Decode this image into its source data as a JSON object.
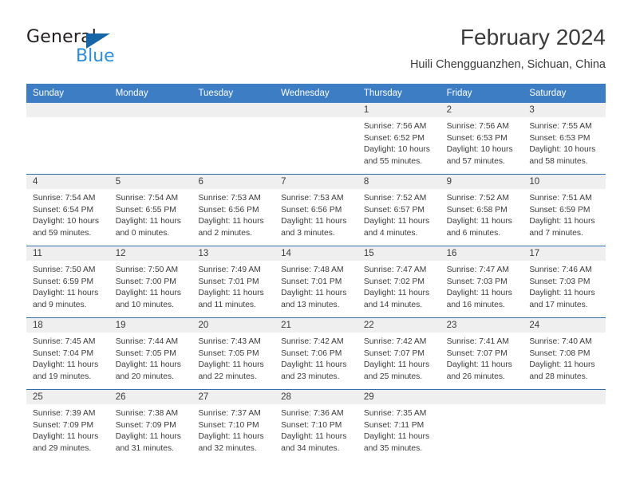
{
  "logo": {
    "word_one": "General",
    "word_two": "Blue",
    "triangle_color": "#1565a8",
    "blue_color": "#2d8fd5"
  },
  "header": {
    "month_title": "February 2024",
    "location": "Huili Chengguanzhen, Sichuan, China"
  },
  "theme": {
    "header_bar": "#3c7dc4",
    "row_divider": "#2f6fb0",
    "day_head_bg": "#efefef",
    "text": "#3b3b3b"
  },
  "weekdays": [
    "Sunday",
    "Monday",
    "Tuesday",
    "Wednesday",
    "Thursday",
    "Friday",
    "Saturday"
  ],
  "weeks": [
    [
      {
        "date": "",
        "lines": [
          "",
          "",
          "",
          ""
        ]
      },
      {
        "date": "",
        "lines": [
          "",
          "",
          "",
          ""
        ]
      },
      {
        "date": "",
        "lines": [
          "",
          "",
          "",
          ""
        ]
      },
      {
        "date": "",
        "lines": [
          "",
          "",
          "",
          ""
        ]
      },
      {
        "date": "1",
        "lines": [
          "Sunrise: 7:56 AM",
          "Sunset: 6:52 PM",
          "Daylight: 10 hours",
          "and 55 minutes."
        ]
      },
      {
        "date": "2",
        "lines": [
          "Sunrise: 7:56 AM",
          "Sunset: 6:53 PM",
          "Daylight: 10 hours",
          "and 57 minutes."
        ]
      },
      {
        "date": "3",
        "lines": [
          "Sunrise: 7:55 AM",
          "Sunset: 6:53 PM",
          "Daylight: 10 hours",
          "and 58 minutes."
        ]
      }
    ],
    [
      {
        "date": "4",
        "lines": [
          "Sunrise: 7:54 AM",
          "Sunset: 6:54 PM",
          "Daylight: 10 hours",
          "and 59 minutes."
        ]
      },
      {
        "date": "5",
        "lines": [
          "Sunrise: 7:54 AM",
          "Sunset: 6:55 PM",
          "Daylight: 11 hours",
          "and 0 minutes."
        ]
      },
      {
        "date": "6",
        "lines": [
          "Sunrise: 7:53 AM",
          "Sunset: 6:56 PM",
          "Daylight: 11 hours",
          "and 2 minutes."
        ]
      },
      {
        "date": "7",
        "lines": [
          "Sunrise: 7:53 AM",
          "Sunset: 6:56 PM",
          "Daylight: 11 hours",
          "and 3 minutes."
        ]
      },
      {
        "date": "8",
        "lines": [
          "Sunrise: 7:52 AM",
          "Sunset: 6:57 PM",
          "Daylight: 11 hours",
          "and 4 minutes."
        ]
      },
      {
        "date": "9",
        "lines": [
          "Sunrise: 7:52 AM",
          "Sunset: 6:58 PM",
          "Daylight: 11 hours",
          "and 6 minutes."
        ]
      },
      {
        "date": "10",
        "lines": [
          "Sunrise: 7:51 AM",
          "Sunset: 6:59 PM",
          "Daylight: 11 hours",
          "and 7 minutes."
        ]
      }
    ],
    [
      {
        "date": "11",
        "lines": [
          "Sunrise: 7:50 AM",
          "Sunset: 6:59 PM",
          "Daylight: 11 hours",
          "and 9 minutes."
        ]
      },
      {
        "date": "12",
        "lines": [
          "Sunrise: 7:50 AM",
          "Sunset: 7:00 PM",
          "Daylight: 11 hours",
          "and 10 minutes."
        ]
      },
      {
        "date": "13",
        "lines": [
          "Sunrise: 7:49 AM",
          "Sunset: 7:01 PM",
          "Daylight: 11 hours",
          "and 11 minutes."
        ]
      },
      {
        "date": "14",
        "lines": [
          "Sunrise: 7:48 AM",
          "Sunset: 7:01 PM",
          "Daylight: 11 hours",
          "and 13 minutes."
        ]
      },
      {
        "date": "15",
        "lines": [
          "Sunrise: 7:47 AM",
          "Sunset: 7:02 PM",
          "Daylight: 11 hours",
          "and 14 minutes."
        ]
      },
      {
        "date": "16",
        "lines": [
          "Sunrise: 7:47 AM",
          "Sunset: 7:03 PM",
          "Daylight: 11 hours",
          "and 16 minutes."
        ]
      },
      {
        "date": "17",
        "lines": [
          "Sunrise: 7:46 AM",
          "Sunset: 7:03 PM",
          "Daylight: 11 hours",
          "and 17 minutes."
        ]
      }
    ],
    [
      {
        "date": "18",
        "lines": [
          "Sunrise: 7:45 AM",
          "Sunset: 7:04 PM",
          "Daylight: 11 hours",
          "and 19 minutes."
        ]
      },
      {
        "date": "19",
        "lines": [
          "Sunrise: 7:44 AM",
          "Sunset: 7:05 PM",
          "Daylight: 11 hours",
          "and 20 minutes."
        ]
      },
      {
        "date": "20",
        "lines": [
          "Sunrise: 7:43 AM",
          "Sunset: 7:05 PM",
          "Daylight: 11 hours",
          "and 22 minutes."
        ]
      },
      {
        "date": "21",
        "lines": [
          "Sunrise: 7:42 AM",
          "Sunset: 7:06 PM",
          "Daylight: 11 hours",
          "and 23 minutes."
        ]
      },
      {
        "date": "22",
        "lines": [
          "Sunrise: 7:42 AM",
          "Sunset: 7:07 PM",
          "Daylight: 11 hours",
          "and 25 minutes."
        ]
      },
      {
        "date": "23",
        "lines": [
          "Sunrise: 7:41 AM",
          "Sunset: 7:07 PM",
          "Daylight: 11 hours",
          "and 26 minutes."
        ]
      },
      {
        "date": "24",
        "lines": [
          "Sunrise: 7:40 AM",
          "Sunset: 7:08 PM",
          "Daylight: 11 hours",
          "and 28 minutes."
        ]
      }
    ],
    [
      {
        "date": "25",
        "lines": [
          "Sunrise: 7:39 AM",
          "Sunset: 7:09 PM",
          "Daylight: 11 hours",
          "and 29 minutes."
        ]
      },
      {
        "date": "26",
        "lines": [
          "Sunrise: 7:38 AM",
          "Sunset: 7:09 PM",
          "Daylight: 11 hours",
          "and 31 minutes."
        ]
      },
      {
        "date": "27",
        "lines": [
          "Sunrise: 7:37 AM",
          "Sunset: 7:10 PM",
          "Daylight: 11 hours",
          "and 32 minutes."
        ]
      },
      {
        "date": "28",
        "lines": [
          "Sunrise: 7:36 AM",
          "Sunset: 7:10 PM",
          "Daylight: 11 hours",
          "and 34 minutes."
        ]
      },
      {
        "date": "29",
        "lines": [
          "Sunrise: 7:35 AM",
          "Sunset: 7:11 PM",
          "Daylight: 11 hours",
          "and 35 minutes."
        ]
      },
      {
        "date": "",
        "lines": [
          "",
          "",
          "",
          ""
        ]
      },
      {
        "date": "",
        "lines": [
          "",
          "",
          "",
          ""
        ]
      }
    ]
  ]
}
